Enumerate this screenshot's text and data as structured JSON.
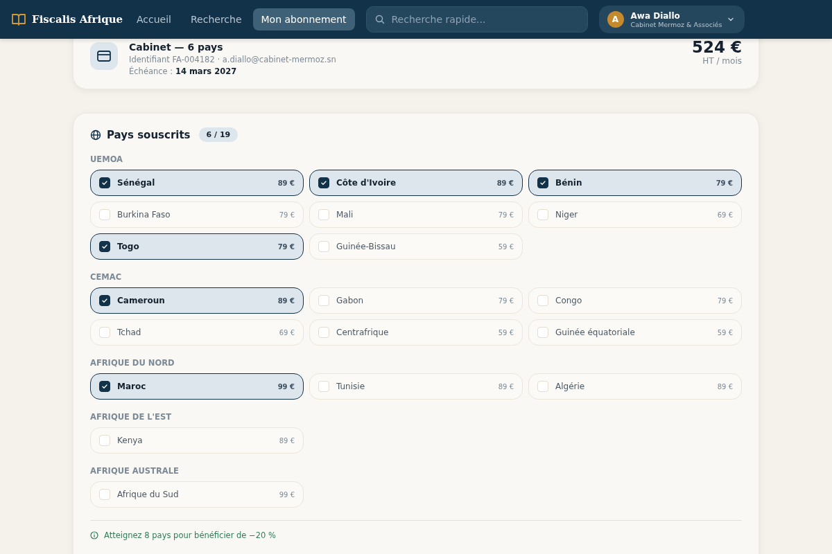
{
  "header": {
    "brand": "Fiscalis Afrique",
    "nav": [
      {
        "label": "Accueil",
        "selected": false
      },
      {
        "label": "Recherche",
        "selected": false
      },
      {
        "label": "Mon abonnement",
        "selected": true
      }
    ],
    "search": {
      "placeholder": "Recherche rapide..."
    },
    "user": {
      "initial": "A",
      "name": "Awa Diallo",
      "company": "Cabinet Mermoz & Associés"
    }
  },
  "plan": {
    "title": "Cabinet — 6 pays",
    "identifier": "Identifiant FA-004182 · a.diallo@cabinet-mermoz.sn",
    "due_label": "Échéance :",
    "due_date": "14 mars 2027",
    "price": "524 €",
    "price_note": "HT / mois"
  },
  "countries": {
    "title": "Pays souscrits",
    "count": "6 / 19",
    "groups": [
      {
        "name": "UEMOA",
        "items": [
          {
            "name": "Sénégal",
            "price": "89 €",
            "checked": true
          },
          {
            "name": "Côte d'Ivoire",
            "price": "89 €",
            "checked": true
          },
          {
            "name": "Bénin",
            "price": "79 €",
            "checked": true
          },
          {
            "name": "Burkina Faso",
            "price": "79 €",
            "checked": false
          },
          {
            "name": "Mali",
            "price": "79 €",
            "checked": false
          },
          {
            "name": "Niger",
            "price": "69 €",
            "checked": false
          },
          {
            "name": "Togo",
            "price": "79 €",
            "checked": true
          },
          {
            "name": "Guinée-Bissau",
            "price": "59 €",
            "checked": false
          }
        ]
      },
      {
        "name": "CEMAC",
        "items": [
          {
            "name": "Cameroun",
            "price": "89 €",
            "checked": true
          },
          {
            "name": "Gabon",
            "price": "79 €",
            "checked": false
          },
          {
            "name": "Congo",
            "price": "79 €",
            "checked": false
          },
          {
            "name": "Tchad",
            "price": "69 €",
            "checked": false
          },
          {
            "name": "Centrafrique",
            "price": "59 €",
            "checked": false
          },
          {
            "name": "Guinée équatoriale",
            "price": "59 €",
            "checked": false
          }
        ]
      },
      {
        "name": "AFRIQUE DU NORD",
        "items": [
          {
            "name": "Maroc",
            "price": "99 €",
            "checked": true
          },
          {
            "name": "Tunisie",
            "price": "89 €",
            "checked": false
          },
          {
            "name": "Algérie",
            "price": "89 €",
            "checked": false
          }
        ]
      },
      {
        "name": "AFRIQUE DE L'EST",
        "items": [
          {
            "name": "Kenya",
            "price": "89 €",
            "checked": false
          }
        ]
      },
      {
        "name": "AFRIQUE AUSTRALE",
        "items": [
          {
            "name": "Afrique du Sud",
            "price": "99 €",
            "checked": false
          }
        ]
      }
    ],
    "hint": "Atteignez 8 pays pour bénéficier de −20 %"
  }
}
